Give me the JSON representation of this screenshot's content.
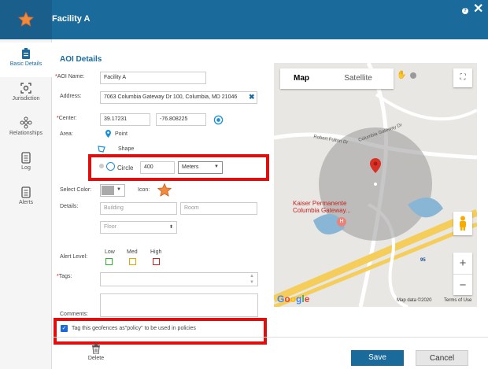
{
  "header": {
    "title": "Facility A",
    "help": "?",
    "close": "✕"
  },
  "sidebar": {
    "items": [
      {
        "label": "Basic Details"
      },
      {
        "label": "Jurisdiction"
      },
      {
        "label": "Relationships"
      },
      {
        "label": "Log"
      },
      {
        "label": "Alerts"
      }
    ]
  },
  "form": {
    "section_title": "AOI Details",
    "aoi_name_label": "AOI Name:",
    "aoi_name_value": "Facility A",
    "address_label": "Address:",
    "address_value": "7063 Columbia Gateway Dr 100, Columbia, MD 21046",
    "center_label": "Center:",
    "center_lat": "39.17231",
    "center_lng": "-76.808225",
    "area_label": "Area:",
    "area_point": "Point",
    "area_shape": "Shape",
    "area_circle": "Circle",
    "radius_value": "400",
    "unit_value": "Meters",
    "select_color_label": "Select Color:",
    "icon_label": "Icon:",
    "details_label": "Details:",
    "building_placeholder": "Building",
    "room_placeholder": "Room",
    "floor_placeholder": "Floor",
    "alert_level_label": "Alert Level:",
    "alert_low": "Low",
    "alert_med": "Med",
    "alert_high": "High",
    "tags_label": "Tags:",
    "comments_label": "Comments:",
    "policy_checkbox_label": "Tag this geofences as\"policy\" to be used in policies",
    "policy_checked": true,
    "colors": {
      "low": "#2db52d",
      "med": "#e0a800",
      "high": "#d62020",
      "accent": "#1a6b9c"
    }
  },
  "map": {
    "tab_map": "Map",
    "tab_satellite": "Satellite",
    "road_robert_fulton": "Robert Fulton Dr",
    "road_columbia_gateway": "Columbia Gateway Dr",
    "poi_name_line1": "Kaiser Permanente",
    "poi_name_line2": "Columbia Gateway...",
    "highway_95": "95",
    "attribution": "Map data ©2020",
    "terms": "Terms of Use",
    "zoom_in": "+",
    "zoom_out": "−",
    "google": "Google"
  },
  "footer": {
    "delete_label": "Delete",
    "save_label": "Save",
    "cancel_label": "Cancel"
  }
}
